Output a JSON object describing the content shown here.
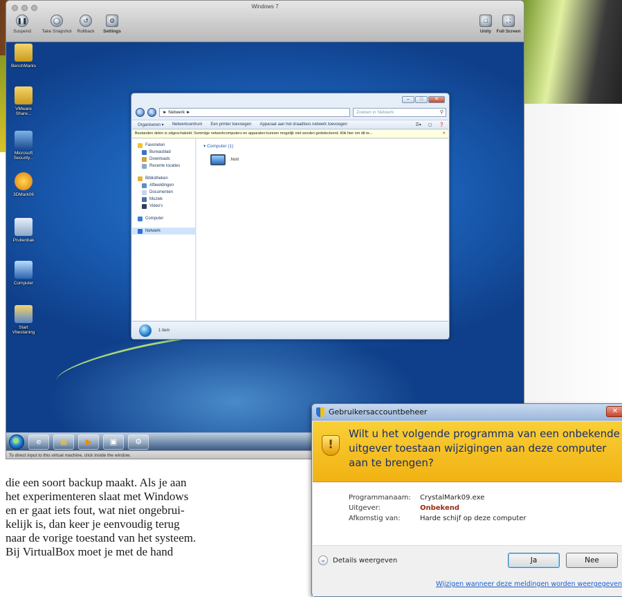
{
  "vm": {
    "window_title": "Windows 7",
    "toolbar": [
      {
        "label": "Suspend",
        "icon": "pause-icon"
      },
      {
        "label": "Take Snapshot",
        "icon": "snapshot-icon"
      },
      {
        "label": "Rollback",
        "icon": "rollback-icon"
      },
      {
        "label": "Settings",
        "icon": "settings-icon"
      },
      {
        "label": "Unity",
        "icon": "unity-icon"
      },
      {
        "label": "Full Screen",
        "icon": "fullscreen-icon"
      }
    ],
    "status_text": "To direct input to this virtual machine, click inside the window."
  },
  "desktop_icons": [
    {
      "label": "BenchMarks",
      "icon": "folder-icon"
    },
    {
      "label": "VMware Share...",
      "icon": "shared-folder-icon"
    },
    {
      "label": "Microsoft Security...",
      "icon": "security-icon"
    },
    {
      "label": "3DMark06",
      "icon": "3dmark-icon"
    },
    {
      "label": "Prullenbak",
      "icon": "recycle-bin-icon"
    },
    {
      "label": "Computer",
      "icon": "computer-icon"
    },
    {
      "label": "Start Vbestaning",
      "icon": "start-icon"
    }
  ],
  "explorer": {
    "address": "Netwerk",
    "search_placeholder": "Zoeken in Netwerk",
    "toolbar": [
      "Organiseren ▾",
      "Netwerkcentrum",
      "Een printer toevoegen",
      "Apparaat aan het draadloos netwerk toevoegen"
    ],
    "infobar": "Bestanden delen is uitgeschakeld. Sommige netwerkcomputers en apparaten kunnen mogelijk niet worden gedetecteerd. Klik hier om dit te...",
    "nav": {
      "favorites": "Favorieten",
      "favorites_items": [
        "Bureaublad",
        "Downloads",
        "Recente locaties"
      ],
      "libraries": "Bibliotheken",
      "libraries_items": [
        "Afbeeldingen",
        "Documenten",
        "Muziek",
        "Video's"
      ],
      "computer": "Computer",
      "network": "Netwerk"
    },
    "group_header": "Computer (1)",
    "item": ".host",
    "status": "1 item"
  },
  "taskbar": [
    "Internet Explorer",
    "Verkenner",
    "Media Player",
    "Netwerk",
    "VMware Tools"
  ],
  "article": {
    "lines": [
      "die een soort backup maakt. Als je aan",
      "het experimenteren slaat met Windows",
      "en er gaat iets fout, wat niet ongebrui-",
      "kelijk is, dan keer je eenvoudig terug",
      "naar de vorige toestand van het systeem.",
      "Bij VirtualBox moet je met de hand"
    ]
  },
  "uac": {
    "title": "Gebruikersaccountbeheer",
    "close": "✕",
    "question": "Wilt u het volgende programma van een onbekende uitgever toestaan wijzigingen aan deze computer aan te brengen?",
    "rows": [
      {
        "key": "Programmanaam:",
        "value": "CrystalMark09.exe"
      },
      {
        "key": "Uitgever:",
        "value": "Onbekend"
      },
      {
        "key": "Afkomstig van:",
        "value": "Harde schijf op deze computer"
      }
    ],
    "details_label": "Details weergeven",
    "yes_label": "Ja",
    "no_label": "Nee",
    "link": "Wijzigen wanneer deze meldingen worden weergegeven"
  }
}
